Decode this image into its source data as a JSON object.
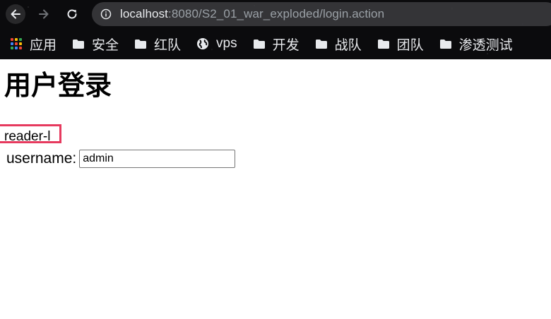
{
  "browser": {
    "url_host": "localhost",
    "url_rest": ":8080/S2_01_war_exploded/login.action",
    "bookmarks": [
      {
        "label": "应用",
        "icon": "apps-grid-icon"
      },
      {
        "label": "安全",
        "icon": "folder-icon"
      },
      {
        "label": "红队",
        "icon": "folder-icon"
      },
      {
        "label": "vps",
        "icon": "globe-icon"
      },
      {
        "label": "开发",
        "icon": "folder-icon"
      },
      {
        "label": "战队",
        "icon": "folder-icon"
      },
      {
        "label": "团队",
        "icon": "folder-icon"
      },
      {
        "label": "渗透测试",
        "icon": "folder-icon"
      }
    ]
  },
  "page": {
    "title": "用户登录",
    "reader_text": "reader-l",
    "username_label": "username:",
    "username_value": "admin"
  },
  "colors": {
    "highlight": "#e63a5e",
    "chrome_bg": "#0b0b0d"
  }
}
